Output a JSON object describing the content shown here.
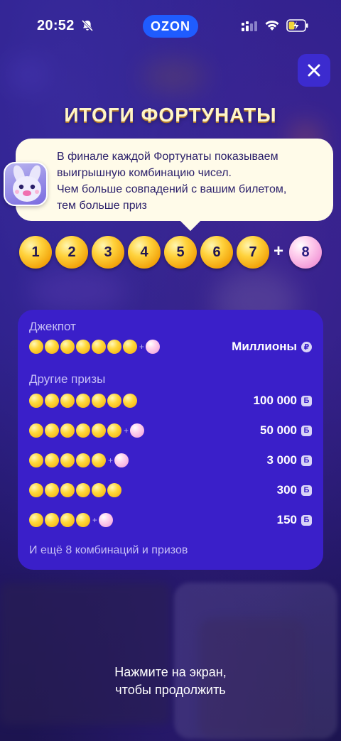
{
  "status_bar": {
    "time": "20:52",
    "app_badge": "OZON",
    "accent": "#1f5cff"
  },
  "header": {
    "title": "ИТОГИ ФОРТУНАТЫ",
    "close_icon": "close-icon"
  },
  "info_bubble": {
    "line1": "В финале каждой Фортунаты показываем",
    "line2": "выигрышную комбинацию чисел.",
    "line3": "Чем больше совпадений с вашим билетом,",
    "line4": "тем больше приз"
  },
  "winning_combination": {
    "main_numbers": [
      "1",
      "2",
      "3",
      "4",
      "5",
      "6",
      "7"
    ],
    "plus": "+",
    "bonus_number": "8"
  },
  "prizes": {
    "jackpot_label": "Джекпот",
    "jackpot": {
      "gold_count": 7,
      "bonus": true,
      "prize": "Миллионы",
      "currency_icon": "ruble-coin-icon"
    },
    "other_label": "Другие призы",
    "rows": [
      {
        "gold_count": 7,
        "bonus": false,
        "prize": "100 000",
        "currency_icon": "points-coin-icon"
      },
      {
        "gold_count": 6,
        "bonus": true,
        "prize": "50 000",
        "currency_icon": "points-coin-icon"
      },
      {
        "gold_count": 5,
        "bonus": true,
        "prize": "3 000",
        "currency_icon": "points-coin-icon"
      },
      {
        "gold_count": 6,
        "bonus": false,
        "prize": "300",
        "currency_icon": "points-coin-icon"
      },
      {
        "gold_count": 4,
        "bonus": true,
        "prize": "150",
        "currency_icon": "points-coin-icon"
      }
    ],
    "more": "И ещё 8 комбинаций и призов",
    "coin_glyph": "Б",
    "ruble_glyph": "₽"
  },
  "footer": {
    "line1": "Нажмите на экран,",
    "line2": "чтобы продолжить"
  }
}
